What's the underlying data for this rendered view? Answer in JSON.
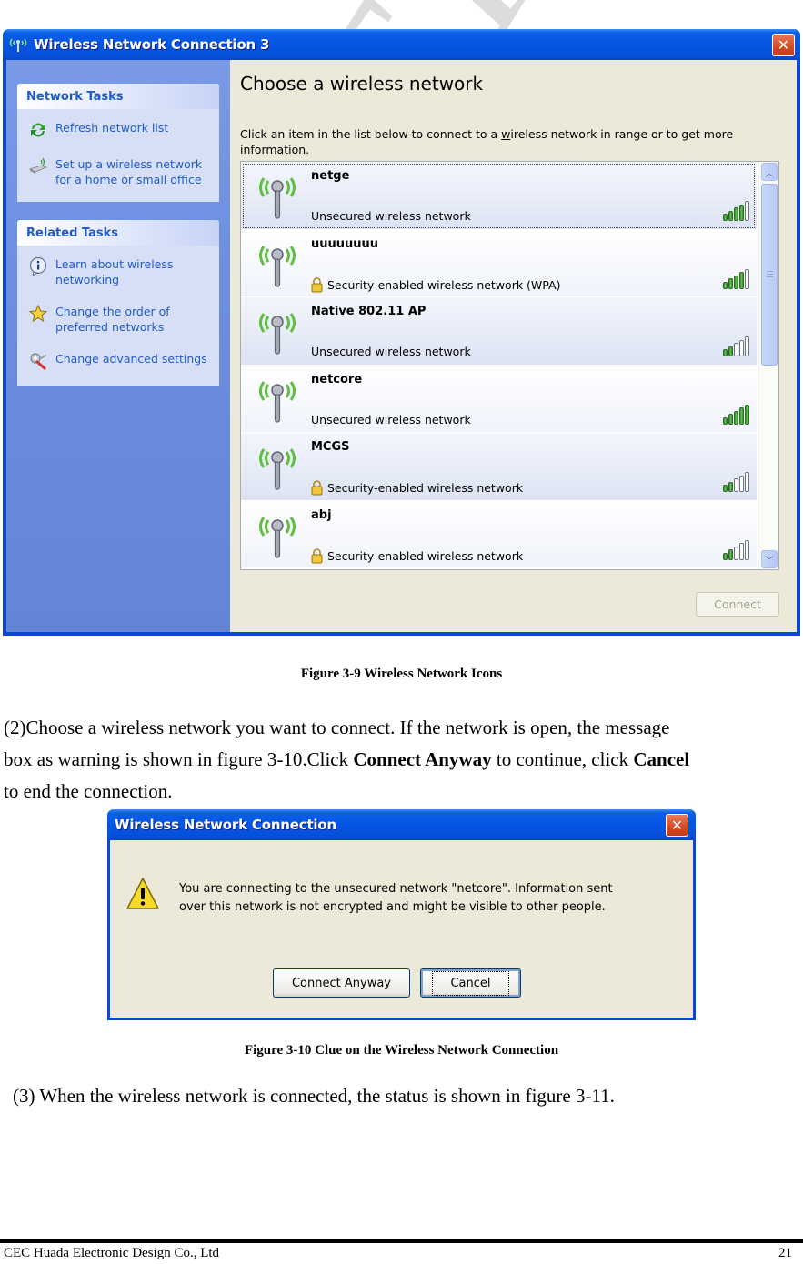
{
  "watermark": "CONFIDENTIAL",
  "figure1": {
    "window_title": "Wireless Network Connection 3",
    "sidebar": {
      "network_tasks": {
        "title": "Network Tasks",
        "items": [
          {
            "label": "Refresh network list",
            "icon": "refresh-icon"
          },
          {
            "label": "Set up a wireless network for a home or small office",
            "icon": "wireless-setup-icon"
          }
        ]
      },
      "related_tasks": {
        "title": "Related Tasks",
        "items": [
          {
            "label": "Learn about wireless networking",
            "icon": "info-icon"
          },
          {
            "label": "Change the order of preferred networks",
            "icon": "star-icon"
          },
          {
            "label": "Change advanced settings",
            "icon": "settings-icon"
          }
        ]
      }
    },
    "content": {
      "heading": "Choose a wireless network",
      "intro_before": "Click an item in the list below to connect to a ",
      "intro_underlined": "w",
      "intro_after": "ireless network in range or to get more information."
    },
    "networks": [
      {
        "ssid": "netge",
        "security": "Unsecured wireless network",
        "secured": false,
        "signal": 4,
        "selected": true
      },
      {
        "ssid": "uuuuuuuu",
        "security": "Security-enabled wireless network (WPA)",
        "secured": true,
        "signal": 4,
        "selected": false
      },
      {
        "ssid": "Native 802.11 AP",
        "security": "Unsecured wireless network",
        "secured": false,
        "signal": 2,
        "selected": false
      },
      {
        "ssid": "netcore",
        "security": "Unsecured wireless network",
        "secured": false,
        "signal": 5,
        "selected": false
      },
      {
        "ssid": "MCGS",
        "security": "Security-enabled wireless network",
        "secured": true,
        "signal": 2,
        "selected": false
      },
      {
        "ssid": "abj",
        "security": "Security-enabled wireless network",
        "secured": true,
        "signal": 2,
        "selected": false
      }
    ],
    "signal_max": 5,
    "connect_button": "Connect",
    "caption": "Figure 3-9 Wireless Network Icons"
  },
  "paragraph2": {
    "line1": "(2)Choose a wireless network you want to connect. If the network is open, the message",
    "line2_before": "box as warning is shown in figure 3-10.Click ",
    "line2_bold1": "Connect Anyway",
    "line2_mid": " to continue, click ",
    "line2_bold2": "Cancel",
    "line3": "to end the connection."
  },
  "figure2": {
    "dialog_title": "Wireless Network Connection",
    "message_line1": "You are connecting to the unsecured network \"netcore\". Information sent",
    "message_line2": "over this network is not encrypted and might be visible to other people.",
    "connect_anyway_button": "Connect Anyway",
    "cancel_button": "Cancel",
    "caption": "Figure 3-10 Clue on the Wireless Network Connection"
  },
  "paragraph3": "(3) When the wireless network is connected, the status is shown in figure 3-11.",
  "footer": {
    "company": "CEC Huada Electronic Design Co., Ltd",
    "page_number": "21"
  }
}
